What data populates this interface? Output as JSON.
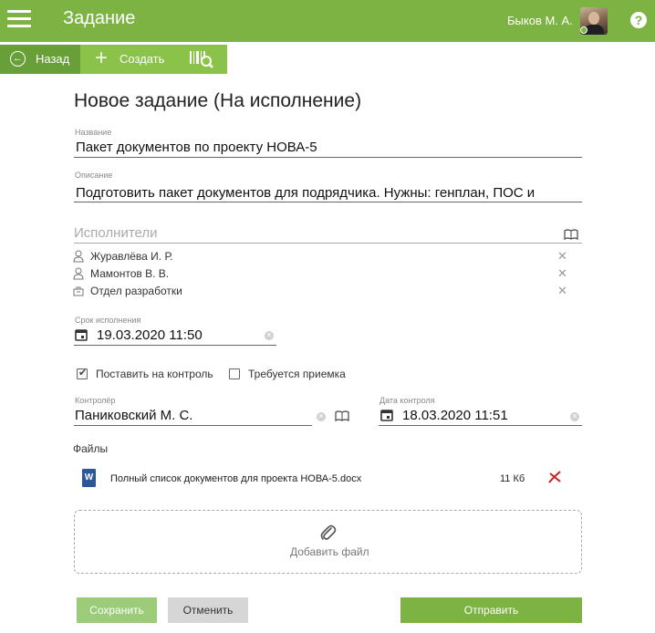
{
  "header": {
    "title": "Задание",
    "user_name": "Быков М. А.",
    "help": "?",
    "accent_color": "#7cb342"
  },
  "toolbar": {
    "back_label": "Назад",
    "create_label": "Создать"
  },
  "form": {
    "page_title": "Новое задание (На исполнение)",
    "name": {
      "label": "Название",
      "value": "Пакет документов по проекту НОВА-5"
    },
    "description": {
      "label": "Описание",
      "value": "Подготовить пакет документов для подрядчика. Нужны: генплан, ПОС и"
    },
    "assignees": {
      "label": "Исполнители",
      "items": [
        {
          "name": "Журавлёва И. Р.",
          "type": "person"
        },
        {
          "name": "Мамонтов В. В.",
          "type": "person"
        },
        {
          "name": "Отдел разработки",
          "type": "department"
        }
      ]
    },
    "deadline": {
      "label": "Срок исполнения",
      "value": "19.03.2020 11:50"
    },
    "checkboxes": {
      "control": {
        "label": "Поставить на контроль",
        "checked": true
      },
      "acceptance": {
        "label": "Требуется приемка",
        "checked": false
      }
    },
    "controller": {
      "label": "Контролёр",
      "value": "Паниковский М. С."
    },
    "control_date": {
      "label": "Дата контроля",
      "value": "18.03.2020 11:51"
    },
    "files": {
      "label": "Файлы",
      "items": [
        {
          "name": "Полный список документов для проекта НОВА-5.docx",
          "size": "11 Кб",
          "icon": "W"
        }
      ],
      "add_label": "Добавить файл"
    }
  },
  "buttons": {
    "save": "Сохранить",
    "cancel": "Отменить",
    "send": "Отправить"
  }
}
